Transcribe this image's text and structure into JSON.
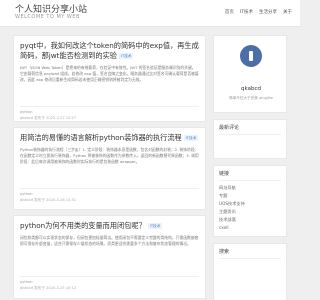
{
  "header": {
    "title": "个人知识分享小站",
    "subtitle": "WELCOME TO MY WEB",
    "nav": [
      "首页",
      "IT技术",
      "生活分享",
      "关于"
    ]
  },
  "posts": [
    {
      "title": "pyqt中，我如何改这个token的简码中的exp值，再生成简码，那jwt能否检测到的实验",
      "badge": "IT技术",
      "excerpt": "JWT（JSON Web Token）是把来的有效载荷，在验证中有效性。JWT 的签名验证是服务端识别的关键。它由载荷信息 payload 组成，若修改 exp 值，签名会随之变化。服务器通过比对签名可确认载荷是否被篡改，因此 exp 修改后重新生成简码若未使用正确密钥则将被判定为无效。",
      "tag": "python",
      "meta": "qkabcd 发布于 2025-3-27 12:27"
    },
    {
      "title": "用简洁的易懂的语言解析python装饰器的执行流程",
      "badge": "IT技术",
      "excerpt": "Python装饰器的执行流程（三步走）1. 定义阶段：装饰器本身是函数，包含对函数的封装；2. 装饰阶段：在函数定义时立即执行装饰器，Python 将被装饰的函数作为参数传入，返回的新函数替代原函数；3. 调用阶段：此后每次调用被装饰的函数时实际执行的是包装函数 wrapper。",
      "tag": "python",
      "meta": "qkabcd 发布于 2025-3-26 13:51"
    },
    {
      "title": "python为何不用类的变量而用闭包呢？",
      "badge": "IT技术",
      "excerpt": "闭包和类都可以实现状态的保存，但闭包更加轻量简洁。使用闭包不需要定义完整的类结构，只需函数嵌套即可保存外部变量，适合只需保存少量状态的场景。而类更适合需要多个方法和复杂状态管理的情况。",
      "tag": "python",
      "meta": "qkabcd 发布于 2025-3-25 10:12"
    }
  ],
  "profile": {
    "name": "qkabcd",
    "desc": "简单不仅大于完美 qingjike"
  },
  "widgets": [
    {
      "title": "最新评论",
      "items": []
    },
    {
      "title": "链接",
      "items": [
        "网址导航",
        "专题",
        "UOS技术支持",
        "主题资讯",
        "技术部落",
        "cxell"
      ]
    },
    {
      "title": "搜索",
      "items": []
    }
  ]
}
